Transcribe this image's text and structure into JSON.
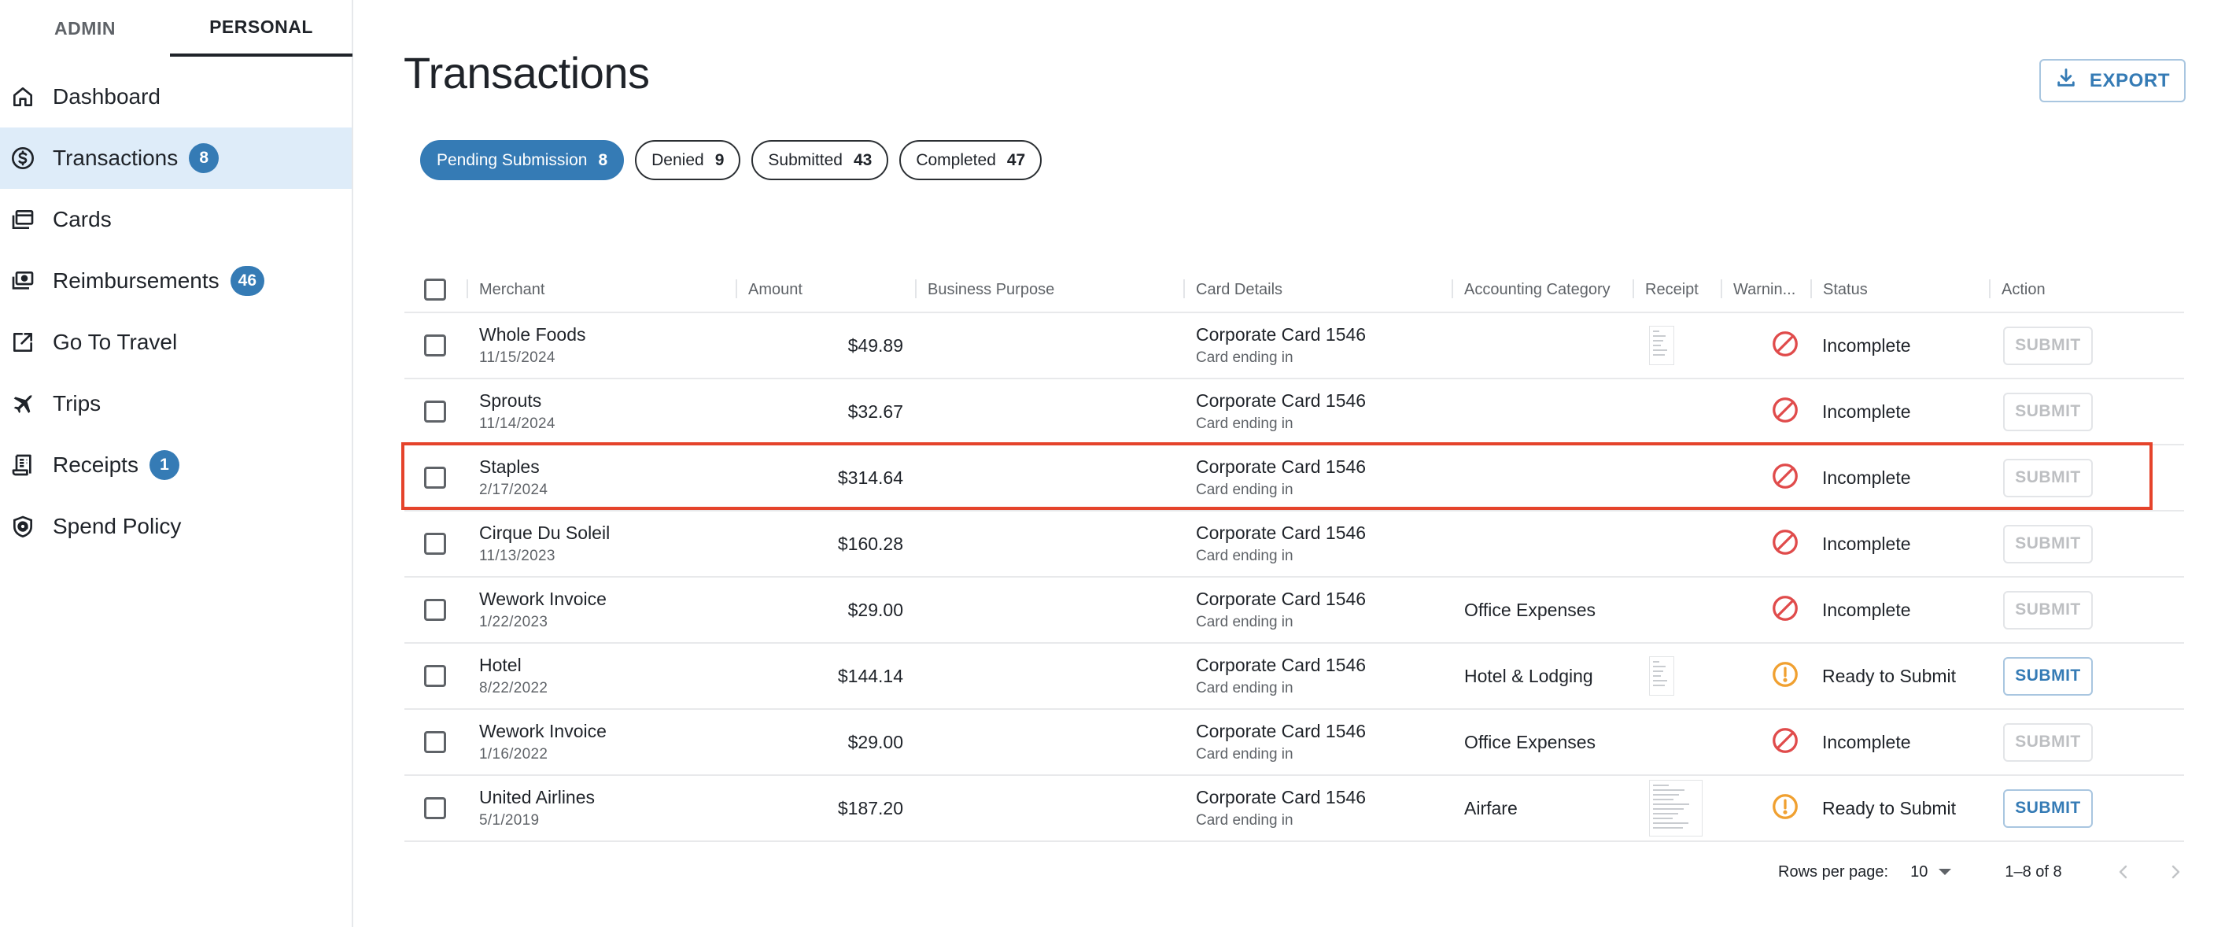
{
  "sidebar": {
    "role_tabs": [
      {
        "label": "ADMIN",
        "active": false
      },
      {
        "label": "PERSONAL",
        "active": true
      }
    ],
    "items": [
      {
        "label": "Dashboard",
        "icon": "home-icon",
        "badge": null,
        "active": false
      },
      {
        "label": "Transactions",
        "icon": "dollar-circle-icon",
        "badge": "8",
        "active": true
      },
      {
        "label": "Cards",
        "icon": "cards-icon",
        "badge": null,
        "active": false
      },
      {
        "label": "Reimbursements",
        "icon": "cash-stack-icon",
        "badge": "46",
        "active": false
      },
      {
        "label": "Go To Travel",
        "icon": "external-link-icon",
        "badge": null,
        "active": false
      },
      {
        "label": "Trips",
        "icon": "airplane-icon",
        "badge": null,
        "active": false
      },
      {
        "label": "Receipts",
        "icon": "receipt-icon",
        "badge": "1",
        "active": false
      },
      {
        "label": "Spend Policy",
        "icon": "shield-policy-icon",
        "badge": null,
        "active": false
      }
    ]
  },
  "header": {
    "title": "Transactions",
    "export_label": "EXPORT"
  },
  "filters": [
    {
      "label": "Pending Submission",
      "count": "8",
      "active": true
    },
    {
      "label": "Denied",
      "count": "9",
      "active": false
    },
    {
      "label": "Submitted",
      "count": "43",
      "active": false
    },
    {
      "label": "Completed",
      "count": "47",
      "active": false
    }
  ],
  "table": {
    "columns": [
      "Merchant",
      "Amount",
      "Business Purpose",
      "Card Details",
      "Accounting Category",
      "Receipt",
      "Warnin...",
      "Status",
      "Action"
    ],
    "rows": [
      {
        "merchant": "Whole Foods",
        "date": "11/15/2024",
        "amount": "$49.89",
        "business_purpose": "",
        "card": "Corporate Card 1546",
        "card_sub": "Card ending in",
        "category": "",
        "receipt": "thumb",
        "warning": "blocked",
        "status": "Incomplete",
        "action": "SUBMIT",
        "action_enabled": false
      },
      {
        "merchant": "Sprouts",
        "date": "11/14/2024",
        "amount": "$32.67",
        "business_purpose": "",
        "card": "Corporate Card 1546",
        "card_sub": "Card ending in",
        "category": "",
        "receipt": null,
        "warning": "blocked",
        "status": "Incomplete",
        "action": "SUBMIT",
        "action_enabled": false
      },
      {
        "merchant": "Staples",
        "date": "2/17/2024",
        "amount": "$314.64",
        "business_purpose": "",
        "card": "Corporate Card 1546",
        "card_sub": "Card ending in",
        "category": "",
        "receipt": null,
        "warning": "blocked",
        "status": "Incomplete",
        "action": "SUBMIT",
        "action_enabled": false,
        "highlighted": true
      },
      {
        "merchant": "Cirque Du Soleil",
        "date": "11/13/2023",
        "amount": "$160.28",
        "business_purpose": "",
        "card": "Corporate Card 1546",
        "card_sub": "Card ending in",
        "category": "",
        "receipt": null,
        "warning": "blocked",
        "status": "Incomplete",
        "action": "SUBMIT",
        "action_enabled": false
      },
      {
        "merchant": "Wework Invoice",
        "date": "1/22/2023",
        "amount": "$29.00",
        "business_purpose": "",
        "card": "Corporate Card 1546",
        "card_sub": "Card ending in",
        "category": "Office Expenses",
        "receipt": null,
        "warning": "blocked",
        "status": "Incomplete",
        "action": "SUBMIT",
        "action_enabled": false
      },
      {
        "merchant": "Hotel",
        "date": "8/22/2022",
        "amount": "$144.14",
        "business_purpose": "",
        "card": "Corporate Card 1546",
        "card_sub": "Card ending in",
        "category": "Hotel & Lodging",
        "receipt": "thumb",
        "warning": "alert",
        "status": "Ready to Submit",
        "action": "SUBMIT",
        "action_enabled": true
      },
      {
        "merchant": "Wework Invoice",
        "date": "1/16/2022",
        "amount": "$29.00",
        "business_purpose": "",
        "card": "Corporate Card 1546",
        "card_sub": "Card ending in",
        "category": "Office Expenses",
        "receipt": null,
        "warning": "blocked",
        "status": "Incomplete",
        "action": "SUBMIT",
        "action_enabled": false
      },
      {
        "merchant": "United Airlines",
        "date": "5/1/2019",
        "amount": "$187.20",
        "business_purpose": "",
        "card": "Corporate Card 1546",
        "card_sub": "Card ending in",
        "category": "Airfare",
        "receipt": "thumb-wide",
        "warning": "alert",
        "status": "Ready to Submit",
        "action": "SUBMIT",
        "action_enabled": true
      }
    ]
  },
  "pagination": {
    "rows_per_page_label": "Rows per page:",
    "rows_per_page_value": "10",
    "range_label": "1–8 of 8"
  },
  "colors": {
    "accent": "#357bb5",
    "active_nav_bg": "#deecf9",
    "blocked": "#e04b4b",
    "alert": "#f0a030",
    "highlight": "#e5432b"
  }
}
